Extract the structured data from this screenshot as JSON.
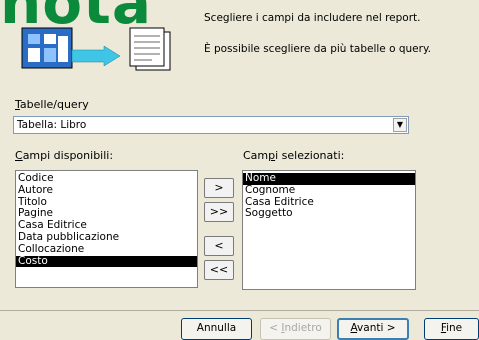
{
  "overlay_text": "nota",
  "header": {
    "line1": "Scegliere i campi da includere nel report.",
    "line2": "È possibile scegliere da più tabelle o query."
  },
  "table_query": {
    "label_accel": "T",
    "label_rest": "abelle/query",
    "selected": "Tabella: Libro"
  },
  "available": {
    "label_accel": "C",
    "label_rest": "ampi disponibili:",
    "items": [
      "Codice",
      "Autore",
      "Titolo",
      "Pagine",
      "Casa Editrice",
      "Data pubblicazione",
      "Collocazione",
      "Costo"
    ],
    "selected_index": 7
  },
  "selected_fields": {
    "label_pre": "Cam",
    "label_accel": "p",
    "label_rest": "i selezionati:",
    "items": [
      "Nome",
      "Cognome",
      "Casa Editrice",
      "Soggetto"
    ],
    "selected_index": 0
  },
  "move_buttons": {
    "add_one": ">",
    "add_all": ">>",
    "remove_one": "<",
    "remove_all": "<<"
  },
  "footer": {
    "cancel": "Annulla",
    "back_pre": "< ",
    "back_accel": "I",
    "back_rest": "ndietro",
    "next_accel": "A",
    "next_rest": "vanti >",
    "finish_accel": "F",
    "finish_rest": "ine"
  },
  "colors": {
    "overlay_green": "#0a8a3a",
    "dialog_bg": "#ece9d8",
    "selection": "#000000"
  }
}
